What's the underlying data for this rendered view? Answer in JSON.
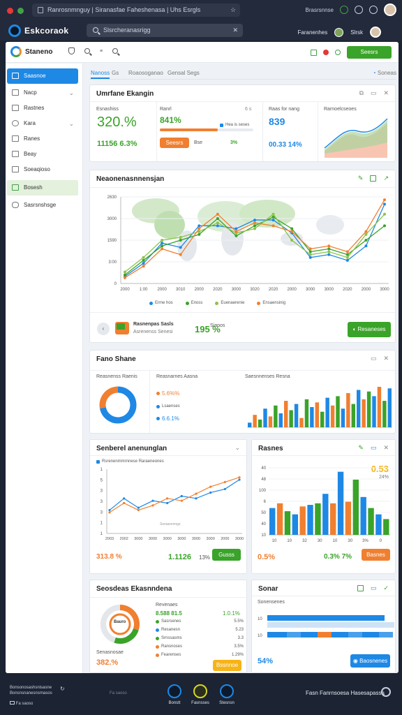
{
  "browser": {
    "url": "Ranrosnmnguy | Siranasfae Faheshenasa | Uhs Esrgls",
    "right_label": "Brasrsnnse"
  },
  "app": {
    "title": "Eskcoraok",
    "search_placeholder": "Slsrcheranasrigg",
    "right_label": "Faranenhes",
    "right_label2": "Slrsk"
  },
  "topstrip": {
    "title": "Staneno"
  },
  "sidebar": {
    "items": [
      {
        "label": "Saasnoe",
        "icon": "dashboard-icon"
      },
      {
        "label": "Nacp",
        "icon": "grid-icon"
      },
      {
        "label": "Rastnes",
        "icon": "list-icon"
      },
      {
        "label": "Kara",
        "icon": "circle-icon"
      },
      {
        "label": "Ranes",
        "icon": "table-icon"
      },
      {
        "label": "Beay",
        "icon": "doc-icon"
      },
      {
        "label": "Soeaqioso",
        "icon": "folder-icon"
      },
      {
        "label": "Bosesh",
        "icon": "page-icon"
      },
      {
        "label": "Sasrsnshsge",
        "icon": "cloud-icon"
      }
    ]
  },
  "tabs": [
    "Nanoss",
    "Gs",
    "Roaosoganao",
    "Gensal Segs",
    "Soneas"
  ],
  "summary": {
    "title": "Umrfane Ekangin",
    "k1": {
      "label": "Esnashiss",
      "value": "320.%",
      "sub": "11156 6.3%"
    },
    "k2": {
      "label": "Ranrl",
      "icon": "6 s",
      "value": "841%",
      "legend": "Hea is seses",
      "button": "Seesrs",
      "s1": "Bse",
      "s2": "3%"
    },
    "k3": {
      "label": "Raas for nang",
      "value": "839",
      "sub": "00.33 14%"
    },
    "k4": {
      "label": "Rarnoelcseoes"
    }
  },
  "linechart": {
    "title": "Neaonenasnnensjan",
    "footer_label": "Rasnenpas Sasls",
    "footer_sub": "Asrenenss Senesi",
    "footer_value": "195 %",
    "footer_value_sub": "Sianos",
    "button": "Resaneses"
  },
  "panel2": {
    "title": "Fano Shane",
    "c1": "Reasnenss Raenis",
    "c2": "Reasnarnes Aasna",
    "c3": "Saesnnenses Resna",
    "v1": "5.6%%",
    "v2": "Lsaenses",
    "v3": "6.6.1%"
  },
  "trend": {
    "title": "Senberel anenunglan",
    "legend": "Rsrenenmmrnnese Raraeneones",
    "xnote": "Sonaesrnngs",
    "v1": "313.8 %",
    "v2": "1.1126",
    "v3": "13%",
    "button": "Gusss"
  },
  "bars": {
    "title": "Rasnes",
    "value": "0.53",
    "value_sub": "24%",
    "v1": "0.5%",
    "v2": "0.3% 7%",
    "button": "Basnes"
  },
  "dist": {
    "title": "Seosdeas Ekasnndena",
    "donut_label": "Bauro",
    "header": "Revenaes",
    "r1": "8.588 81.5",
    "r1b": "1.0.1%",
    "items": [
      "Sasrsenes",
      "Resanesn",
      "Srnssasms",
      "Ransnoses",
      "Fearenses"
    ],
    "vals": [
      "5.5%",
      "5.23",
      "3.3",
      "3.5%",
      "1.29%"
    ],
    "foot": "Senasnosae",
    "pct": "382.%",
    "button": "Bssnnoe"
  },
  "sonar": {
    "title": "Sonar",
    "label": "Sonensenes",
    "value": "54%",
    "button": "Baosnenes"
  },
  "bottom": {
    "left1": "Bonsonosashsnisasne",
    "left2": "Bonsnsnanesnsrnasos",
    "center_label": "Fa saoso",
    "nav": [
      "Bonstt",
      "Fasnsses",
      "Stesnsn"
    ],
    "right": "Fasn Fanrnsoesa Hasesapassa"
  },
  "chart_data": [
    {
      "type": "line",
      "title": "Neaonenasnnensjan",
      "x": [
        "2000",
        "1:00",
        "2000",
        "3010",
        "2000",
        "2020",
        "3000",
        "3020",
        "2020",
        "2000",
        "3000",
        "3000",
        "2020",
        "2000",
        "3000"
      ],
      "ylabels": [
        "2630",
        "3000",
        "1590",
        "3:00",
        "0"
      ],
      "series": [
        {
          "name": "Erme hos",
          "values": [
            5,
            14,
            28,
            25,
            40,
            40,
            38,
            44,
            44,
            35,
            18,
            20,
            16,
            26,
            55
          ]
        },
        {
          "name": "Enoss",
          "values": [
            6,
            16,
            26,
            30,
            34,
            45,
            33,
            40,
            46,
            38,
            22,
            24,
            20,
            30,
            40
          ]
        },
        {
          "name": "Euenaerenie",
          "values": [
            8,
            18,
            30,
            32,
            36,
            42,
            35,
            38,
            48,
            30,
            20,
            22,
            18,
            34,
            48
          ]
        },
        {
          "name": "Ensaensinig",
          "values": [
            4,
            12,
            24,
            20,
            38,
            48,
            36,
            42,
            40,
            36,
            24,
            26,
            22,
            36,
            58
          ]
        }
      ],
      "colors": [
        "#1e88e5",
        "#3aa329",
        "#8bc34a",
        "#f07f30"
      ]
    },
    {
      "type": "bar",
      "title": "Saesnnenses Resna",
      "values": [
        3,
        8,
        5,
        12,
        7,
        14,
        9,
        17,
        11,
        15,
        6,
        18,
        13,
        16,
        10,
        19,
        14,
        20,
        12,
        22,
        15,
        24,
        18,
        23,
        20,
        26,
        17,
        25
      ],
      "colors": [
        "#1e88e5",
        "#f07f30",
        "#3aa329"
      ]
    },
    {
      "type": "line",
      "title": "Senberel anenunglan",
      "x": [
        "2003",
        "2002",
        "3000",
        "3000",
        "3000",
        "3000",
        "3000",
        "3000",
        "2000",
        "3000"
      ],
      "ylabels": [
        "1",
        "5",
        "3",
        "3",
        "3",
        "1",
        "1"
      ],
      "series": [
        {
          "name": "A",
          "values": [
            20,
            30,
            22,
            28,
            26,
            32,
            30,
            35,
            38,
            46
          ]
        },
        {
          "name": "B",
          "values": [
            18,
            26,
            20,
            24,
            30,
            28,
            34,
            40,
            44,
            48
          ]
        }
      ],
      "colors": [
        "#1e88e5",
        "#f07f30"
      ]
    },
    {
      "type": "bar",
      "title": "Rasnes",
      "ylabels": [
        "40",
        "48",
        "100",
        "6",
        "50",
        "40",
        "10"
      ],
      "x": [
        "10",
        "10",
        "32",
        "30",
        "10",
        "30",
        "3%",
        "0"
      ],
      "values": [
        34,
        40,
        30,
        26,
        36,
        38,
        40,
        52,
        40,
        80,
        42,
        70,
        48,
        34,
        26,
        20
      ],
      "colors": [
        "#1e88e5",
        "#f07f30",
        "#3aa329",
        "#1e88e5",
        "#f07f30",
        "#1e88e5",
        "#3aa329",
        "#1e88e5",
        "#f07f30",
        "#1e88e5",
        "#f07f30",
        "#3aa329",
        "#1e88e5",
        "#3aa329",
        "#1e88e5",
        "#3aa329"
      ]
    },
    {
      "type": "pie",
      "title": "Fano Shane",
      "values": [
        72,
        28
      ],
      "colors": [
        "#1e88e5",
        "#f07f30"
      ]
    }
  ]
}
